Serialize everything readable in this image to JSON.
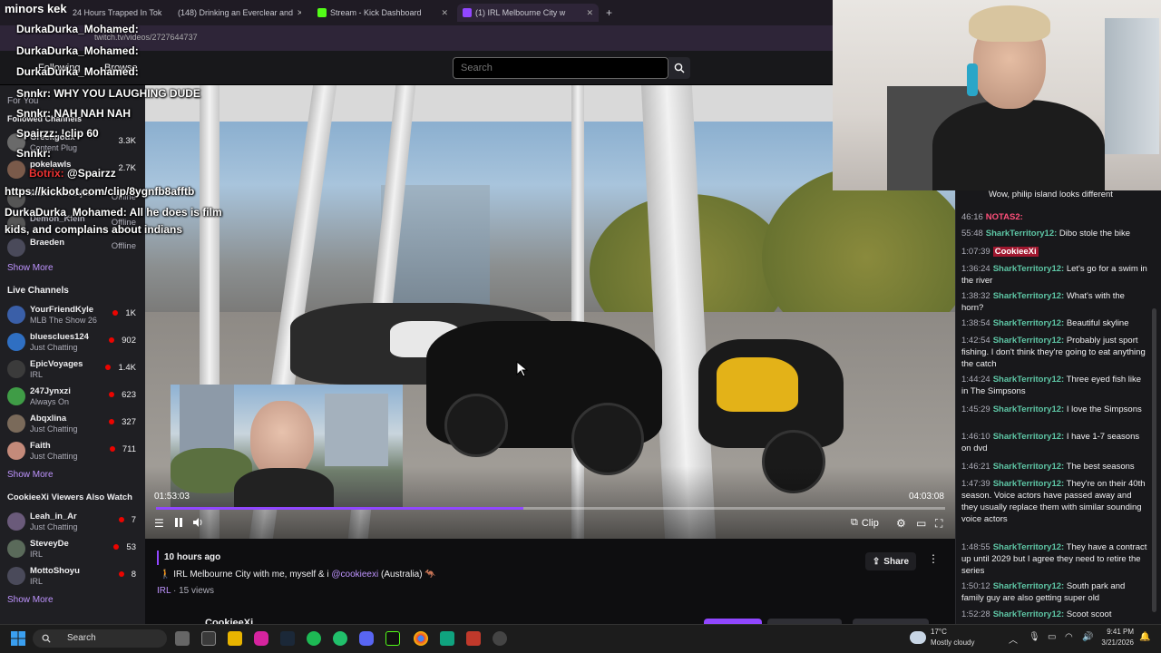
{
  "overlay_title": "minors kek",
  "browser": {
    "tabs": [
      {
        "label": "24 Hours Trapped In Tok",
        "color": "#ff0000"
      },
      {
        "label": "(148) Drinking an Everclear and",
        "color": "#ff0000"
      },
      {
        "label": "Stream - Kick Dashboard",
        "color": "#53fc18"
      },
      {
        "label": "(1) IRL Melbourne City w",
        "color": "#9147ff"
      }
    ],
    "new_tab": "+",
    "url": "twitch.tv/videos/2727644737"
  },
  "nav": {
    "following": "Following",
    "browse": "Browse",
    "search_placeholder": "Search"
  },
  "sidebar": {
    "for_you": "For You",
    "followed_header": "Followed Channels",
    "followed": [
      {
        "name": "Greekgodx",
        "game": "Content Plug",
        "viewers": "3.3K"
      },
      {
        "name": "pokelawls",
        "game": "",
        "viewers": "2.7K"
      },
      {
        "name": "imbossshanjack",
        "game": "",
        "viewers": "Offline"
      },
      {
        "name": "Demon_Klein",
        "game": "",
        "viewers": "Offline"
      },
      {
        "name": "Braeden",
        "game": "",
        "viewers": "Offline"
      }
    ],
    "show_more_1": "Show More",
    "live_header": "Live Channels",
    "live": [
      {
        "name": "YourFriendKyle",
        "game": "MLB The Show 26",
        "viewers": "1K",
        "color": "#3a5fa8"
      },
      {
        "name": "bluesclues124",
        "game": "Just Chatting",
        "viewers": "902",
        "color": "#2f6fc2"
      },
      {
        "name": "EpicVoyages",
        "game": "IRL",
        "viewers": "1.4K",
        "color": "#3b3b3b"
      },
      {
        "name": "247Jynxzi",
        "game": "Always On",
        "viewers": "623",
        "color": "#3f9c46"
      },
      {
        "name": "Abqxlina",
        "game": "Just Chatting",
        "viewers": "327",
        "color": "#7a6a5a"
      },
      {
        "name": "Faith",
        "game": "Just Chatting",
        "viewers": "711",
        "color": "#c48a7a"
      }
    ],
    "show_more_2": "Show More",
    "also_header": "CookieeXi Viewers Also Watch",
    "also": [
      {
        "name": "Leah_in_Ar",
        "game": "Just Chatting",
        "viewers": "7",
        "color": "#6a5a7a"
      },
      {
        "name": "SteveyDe",
        "game": "IRL",
        "viewers": "53",
        "color": "#5a6a5a"
      },
      {
        "name": "MottoShoyu",
        "game": "IRL",
        "viewers": "8",
        "color": "#4a4a5a"
      }
    ],
    "show_more_3": "Show More"
  },
  "overlay_chat": [
    {
      "user": "DurkaDurka_Mohamed:",
      "text": ""
    },
    {
      "user": "DurkaDurka_Mohamed:",
      "text": ""
    },
    {
      "user": "DurkaDurka_Mohamed:",
      "text": ""
    },
    {
      "user": "Snnkr:",
      "text": "WHY YOU LAUGHING DUDE"
    },
    {
      "user": "Snnkr:",
      "text": "NAH NAH NAH"
    },
    {
      "user": "Spairzz:",
      "text": "!clip 60"
    },
    {
      "user": "Snnkr:",
      "text": ""
    },
    {
      "user": "Botrix:",
      "text": "@Spairzz"
    },
    {
      "user": "",
      "text": "https://kickbot.com/clip/8ygnfb8afftb"
    },
    {
      "user": "DurkaDurka_Mohamed:",
      "text": "All he does is film kids, and complains about indians"
    }
  ],
  "player": {
    "current_time": "01:53:03",
    "total_time": "04:03:08",
    "progress": 0.465,
    "clip_label": "Clip"
  },
  "video_info": {
    "ago": "10 hours ago",
    "title_prefix": "🚶 IRL Melbourne City with me, myself & i",
    "mention": "@cookieexi",
    "title_suffix": "(Australia) 🦘",
    "category": "IRL",
    "views": "· 15 views",
    "share": "Share",
    "streamer": "CookieeXi"
  },
  "chat": [
    {
      "ts": "",
      "user": "",
      "text": "Wow, philip island looks different"
    },
    {
      "ts": "46:16",
      "user": "NOTAS2:",
      "text": "",
      "user_color": "#ff4f7a"
    },
    {
      "ts": "55:48",
      "user": "SharkTerritory12:",
      "text": "Dibo stole the bike"
    },
    {
      "ts": "1:07:39",
      "user": "CookieeXi",
      "text": "",
      "user_color": "#ff4f7a"
    },
    {
      "ts": "1:36:24",
      "user": "SharkTerritory12:",
      "text": "Let's go for a swim in the river"
    },
    {
      "ts": "1:38:32",
      "user": "SharkTerritory12:",
      "text": "What's with the horn?"
    },
    {
      "ts": "1:38:54",
      "user": "SharkTerritory12:",
      "text": "Beautiful skyline"
    },
    {
      "ts": "1:42:54",
      "user": "SharkTerritory12:",
      "text": "Probably just sport fishing. I don't think they're going to eat anything the catch"
    },
    {
      "ts": "1:44:24",
      "user": "SharkTerritory12:",
      "text": "Three eyed fish like in The Simpsons"
    },
    {
      "ts": "1:45:29",
      "user": "SharkTerritory12:",
      "text": "I love the Simpsons"
    },
    {
      "ts": "1:46:10",
      "user": "SharkTerritory12:",
      "text": "I have 1-7 seasons on dvd"
    },
    {
      "ts": "1:46:21",
      "user": "SharkTerritory12:",
      "text": "The best seasons"
    },
    {
      "ts": "1:47:39",
      "user": "SharkTerritory12:",
      "text": "They're on their 40th season. Voice actors have passed away and they usually replace them with similar sounding voice actors"
    },
    {
      "ts": "1:48:55",
      "user": "SharkTerritory12:",
      "text": "They have a contract up until 2029 but I agree they need to retire the series"
    },
    {
      "ts": "1:50:12",
      "user": "SharkTerritory12:",
      "text": "South park and family guy are also getting super old"
    },
    {
      "ts": "1:52:28",
      "user": "SharkTerritory12:",
      "text": "Scoot scoot"
    }
  ],
  "taskbar": {
    "search": "Search",
    "temp": "17°C",
    "weather": "Mostly cloudy",
    "time": "9:41 PM",
    "date": "3/21/2026"
  },
  "colors": {
    "accent": "#9147ff",
    "chat_user": "#5ec7a6",
    "link": "#bf94ff"
  }
}
